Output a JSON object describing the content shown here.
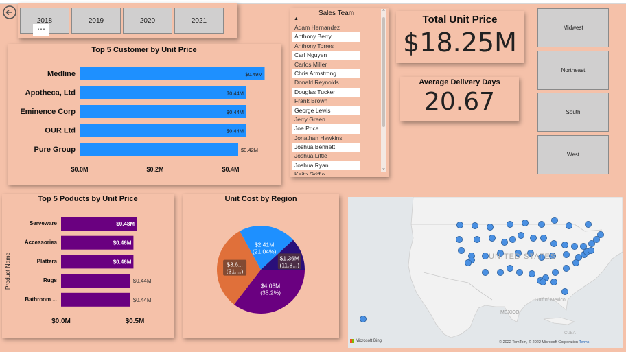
{
  "years": {
    "items": [
      "2018",
      "2019",
      "2020",
      "2021"
    ]
  },
  "top_customers": {
    "title": "Top 5 Customer by Unit Price",
    "x_ticks": [
      "$0.0M",
      "$0.2M",
      "$0.4M"
    ]
  },
  "sales_team": {
    "title": "Sales Team",
    "members": [
      "Adam Hernandez",
      "Anthony Berry",
      "Anthony Torres",
      "Carl Nguyen",
      "Carlos Miller",
      "Chris Armstrong",
      "Donald Reynolds",
      "Douglas Tucker",
      "Frank Brown",
      "George Lewis",
      "Jerry Green",
      "Joe Price",
      "Jonathan Hawkins",
      "Joshua Bennett",
      "Joshua Little",
      "Joshua Ryan",
      "Keith Griffin"
    ]
  },
  "kpi_unit_price": {
    "title": "Total Unit Price",
    "value": "$18.25M"
  },
  "kpi_delivery": {
    "title": "Average Delivery Days",
    "value": "20.67"
  },
  "regions": {
    "items": [
      "Midwest",
      "Northeast",
      "South",
      "West"
    ]
  },
  "top_products": {
    "title": "Top 5 Poducts by Unit Price",
    "y_axis_label": "Product Name",
    "x_ticks": [
      "$0.0M",
      "$0.5M"
    ]
  },
  "unit_cost_region": {
    "title": "Unit Cost by Region"
  },
  "map": {
    "country_label": "UNITED STATES",
    "mexico_label": "MEXICO",
    "gulf_label": "Gulf of\nMexico",
    "cuba_label": "CUBA",
    "bing_label": "Microsoft Bing",
    "copyright": "© 2022 TomTom, © 2022 Microsoft Corporation",
    "terms": "Terms"
  },
  "colors": {
    "background": "#f5c1a9",
    "customer_bar": "#1e90ff",
    "product_bar": "#6a0080",
    "pie_blue": "#1e90ff",
    "pie_navy": "#2a0f7a",
    "pie_purple": "#6a0080",
    "pie_orange": "#e0703a",
    "map_dot": "#4a90e2"
  },
  "chart_data": [
    {
      "type": "bar",
      "title": "Top 5 Customer by Unit Price",
      "orientation": "horizontal",
      "categories": [
        "Medline",
        "Apotheca, Ltd",
        "Eminence Corp",
        "OUR Ltd",
        "Pure Group"
      ],
      "values": [
        0.49,
        0.44,
        0.44,
        0.44,
        0.42
      ],
      "labels": [
        "$0.49M",
        "$0.44M",
        "$0.44M",
        "$0.44M",
        "$0.42M"
      ],
      "xlim": [
        0,
        0.5
      ],
      "unit": "$M"
    },
    {
      "type": "bar",
      "title": "Top 5 Poducts by Unit Price",
      "orientation": "horizontal",
      "categories": [
        "Serveware",
        "Accessories",
        "Platters",
        "Rugs",
        "Bathroom ..."
      ],
      "values": [
        0.48,
        0.46,
        0.46,
        0.44,
        0.44
      ],
      "labels": [
        "$0.48M",
        "$0.46M",
        "$0.46M",
        "$0.44M",
        "$0.44M"
      ],
      "ylabel": "Product Name",
      "xlim": [
        0,
        0.6
      ],
      "unit": "$M"
    },
    {
      "type": "pie",
      "title": "Unit Cost by Region",
      "slices": [
        {
          "value": 2.41,
          "label": "$2.41M",
          "pct": "(21.04%)"
        },
        {
          "value": 1.36,
          "label": "$1.36M",
          "pct": "(11.8...)"
        },
        {
          "value": 4.03,
          "label": "$4.03M",
          "pct": "(35.2%)"
        },
        {
          "value": 3.6,
          "label": "$3.6...",
          "pct": "(31....)"
        }
      ]
    }
  ]
}
